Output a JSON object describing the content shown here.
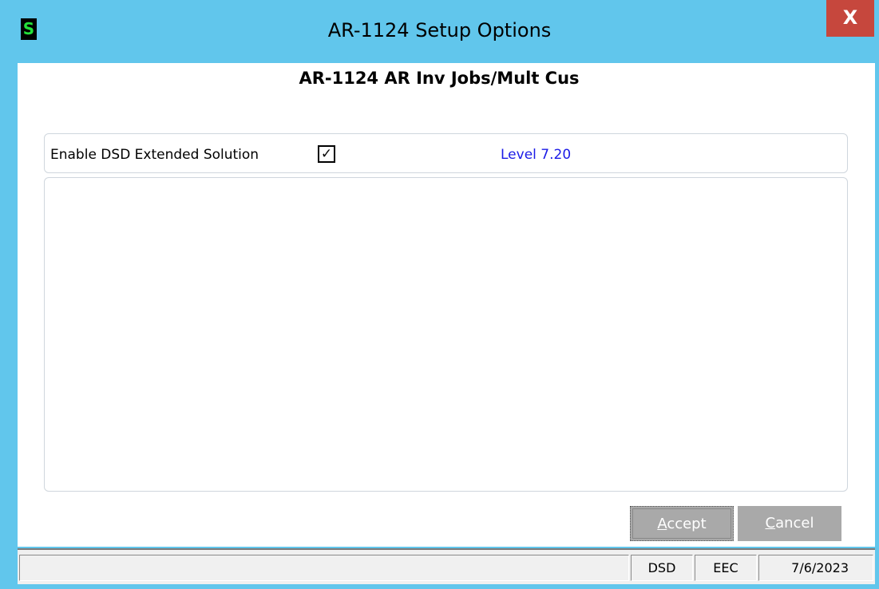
{
  "window": {
    "title": "AR-1124 Setup Options",
    "app_icon_letter": "S",
    "close_label": "X"
  },
  "main": {
    "heading": "AR-1124 AR Inv Jobs/Mult Cus",
    "enable_label": "Enable DSD Extended Solution",
    "enable_checked": true,
    "enable_check_glyph": "✓",
    "level_text": "Level  7.20"
  },
  "buttons": {
    "accept": {
      "mnemonic": "A",
      "rest": "ccept"
    },
    "cancel": {
      "mnemonic": "C",
      "rest": "ancel"
    }
  },
  "statusbar": {
    "cell1": "DSD",
    "cell2": "EEC",
    "date": "7/6/2023"
  },
  "colors": {
    "titlebar": "#61c6ec",
    "close": "#c6473d",
    "level_text": "#1a1ae6",
    "button_disabled": "#a9a9a9"
  }
}
